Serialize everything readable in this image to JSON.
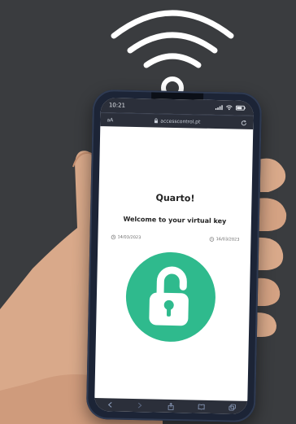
{
  "status": {
    "time": "10:21"
  },
  "browser": {
    "left_label": "aA",
    "url": "accesscontrol.pt"
  },
  "page": {
    "title": "Quarto!",
    "subtitle": "Welcome to your virtual key",
    "checkin": "14/03/2023",
    "checkout": "16/03/2023"
  },
  "colors": {
    "background": "#3a3c3f",
    "accent": "#2fba8d",
    "phone": "#1c2436",
    "wifi": "#ffffff"
  },
  "icons": {
    "unlock": "unlocked-padlock-icon",
    "wifi": "wifi-signal-icon"
  }
}
